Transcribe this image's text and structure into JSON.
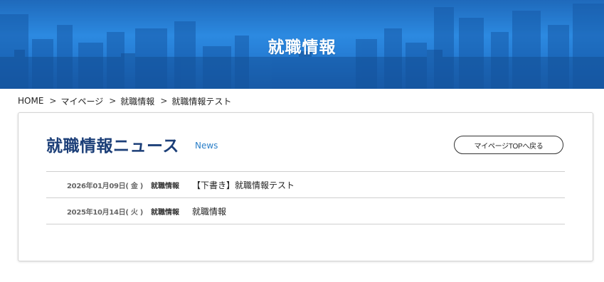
{
  "hero": {
    "title": "就職情報"
  },
  "breadcrumb": {
    "items": [
      "HOME",
      "マイページ",
      "就職情報",
      "就職情報テスト"
    ],
    "separator": ">"
  },
  "news_section": {
    "title": "就職情報ニュース",
    "subtitle": "News",
    "top_button_label": "マイページTOPへ戻る",
    "items": [
      {
        "date": "2026年01月09日( 金 )",
        "category": "就職情報",
        "title": "【下書き】就職情報テスト"
      },
      {
        "date": "2025年10月14日( 火 )",
        "category": "就職情報",
        "title": "就職情報"
      }
    ]
  },
  "colors": {
    "title_navy": "#1c3f78",
    "accent_blue": "#2b7fc8",
    "hero_blue": "#2a86de"
  }
}
